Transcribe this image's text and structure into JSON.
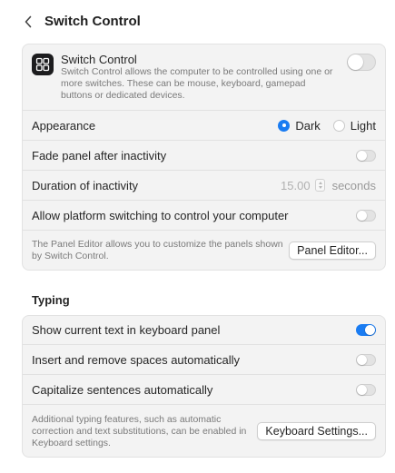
{
  "header": {
    "title": "Switch Control"
  },
  "colors": {
    "accent": "#1a7cf2",
    "card_bg": "#f3f3f3"
  },
  "switch_control": {
    "title": "Switch Control",
    "description": "Switch Control allows the computer to be controlled using one or more switches. These can be mouse, keyboard, gamepad buttons or dedicated devices.",
    "enabled": false
  },
  "appearance": {
    "label": "Appearance",
    "options": [
      "Dark",
      "Light"
    ],
    "selected": "Dark"
  },
  "fade_panel": {
    "label": "Fade panel after inactivity",
    "enabled": false
  },
  "duration": {
    "label": "Duration of inactivity",
    "value": "15.00",
    "unit": "seconds"
  },
  "platform_switching": {
    "label": "Allow platform switching to control your computer",
    "enabled": false
  },
  "panel_editor": {
    "note": "The Panel Editor allows you to customize the panels shown by Switch Control.",
    "button_label": "Panel Editor..."
  },
  "typing": {
    "section_title": "Typing",
    "show_text": {
      "label": "Show current text in keyboard panel",
      "enabled": true
    },
    "spaces": {
      "label": "Insert and remove spaces automatically",
      "enabled": false
    },
    "capitalize": {
      "label": "Capitalize sentences automatically",
      "enabled": false
    },
    "keyboard_settings": {
      "note": "Additional typing features, such as automatic correction and text substitutions, can be enabled in Keyboard settings.",
      "button_label": "Keyboard Settings..."
    }
  }
}
